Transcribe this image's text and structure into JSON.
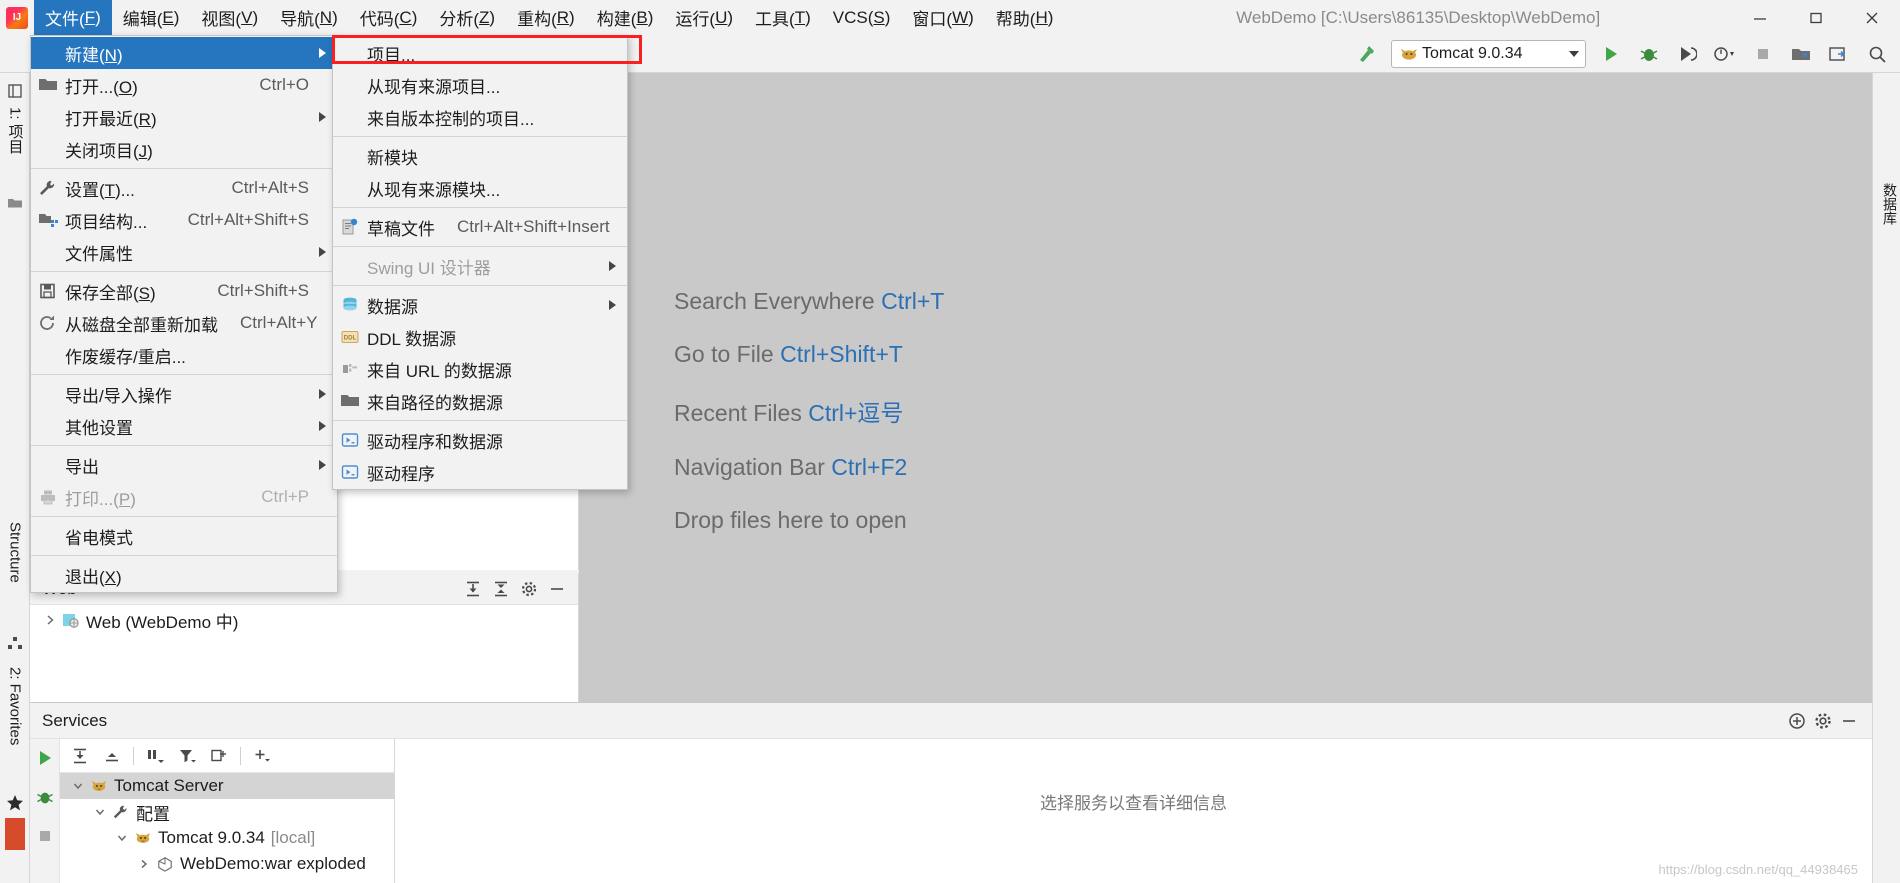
{
  "window": {
    "title": "WebDemo [C:\\Users\\86135\\Desktop\\WebDemo]",
    "logo_name": "intellij-idea-logo",
    "minimize_label": "最小化",
    "maximize_label": "最大化",
    "close_label": "关闭"
  },
  "menubar": [
    {
      "label": "文件(F)",
      "mnemonic": "F",
      "active": true
    },
    {
      "label": "编辑(E)",
      "mnemonic": "E",
      "active": false
    },
    {
      "label": "视图(V)",
      "mnemonic": "V",
      "active": false
    },
    {
      "label": "导航(N)",
      "mnemonic": "N",
      "active": false
    },
    {
      "label": "代码(C)",
      "mnemonic": "C",
      "active": false
    },
    {
      "label": "分析(Z)",
      "mnemonic": "Z",
      "active": false
    },
    {
      "label": "重构(R)",
      "mnemonic": "R",
      "active": false
    },
    {
      "label": "构建(B)",
      "mnemonic": "B",
      "active": false
    },
    {
      "label": "运行(U)",
      "mnemonic": "U",
      "active": false
    },
    {
      "label": "工具(T)",
      "mnemonic": "T",
      "active": false
    },
    {
      "label": "VCS(S)",
      "mnemonic": "S",
      "active": false
    },
    {
      "label": "窗口(W)",
      "mnemonic": "W",
      "active": false
    },
    {
      "label": "帮助(H)",
      "mnemonic": "H",
      "active": false
    }
  ],
  "file_menu": [
    {
      "label": "新建(N)",
      "icon": "",
      "accel": "",
      "submenu": true,
      "highlight": true,
      "disabled": false
    },
    {
      "label": "打开...(O)",
      "icon": "folder-icon",
      "accel": "Ctrl+O",
      "submenu": false,
      "highlight": false,
      "disabled": false
    },
    {
      "label": "打开最近(R)",
      "icon": "",
      "accel": "",
      "submenu": true,
      "highlight": false,
      "disabled": false
    },
    {
      "label": "关闭项目(J)",
      "icon": "",
      "accel": "",
      "submenu": false,
      "highlight": false,
      "disabled": false
    },
    {
      "separator": true
    },
    {
      "label": "设置(T)...",
      "icon": "wrench-icon",
      "accel": "Ctrl+Alt+S",
      "submenu": false,
      "highlight": false,
      "disabled": false
    },
    {
      "label": "项目结构...",
      "icon": "project-structure-icon",
      "accel": "Ctrl+Alt+Shift+S",
      "submenu": false,
      "highlight": false,
      "disabled": false
    },
    {
      "label": "文件属性",
      "icon": "",
      "accel": "",
      "submenu": true,
      "highlight": false,
      "disabled": false
    },
    {
      "separator": true
    },
    {
      "label": "保存全部(S)",
      "icon": "save-icon",
      "accel": "Ctrl+Shift+S",
      "submenu": false,
      "highlight": false,
      "disabled": false
    },
    {
      "label": "从磁盘全部重新加载",
      "icon": "reload-icon",
      "accel": "Ctrl+Alt+Y",
      "submenu": false,
      "highlight": false,
      "disabled": false
    },
    {
      "label": "作废缓存/重启...",
      "icon": "",
      "accel": "",
      "submenu": false,
      "highlight": false,
      "disabled": false
    },
    {
      "separator": true
    },
    {
      "label": "导出/导入操作",
      "icon": "",
      "accel": "",
      "submenu": true,
      "highlight": false,
      "disabled": false
    },
    {
      "label": "其他设置",
      "icon": "",
      "accel": "",
      "submenu": true,
      "highlight": false,
      "disabled": false
    },
    {
      "separator": true
    },
    {
      "label": "导出",
      "icon": "",
      "accel": "",
      "submenu": true,
      "highlight": false,
      "disabled": false
    },
    {
      "label": "打印...(P)",
      "icon": "printer-icon",
      "accel": "Ctrl+P",
      "submenu": false,
      "highlight": false,
      "disabled": true
    },
    {
      "separator": true
    },
    {
      "label": "省电模式",
      "icon": "",
      "accel": "",
      "submenu": false,
      "highlight": false,
      "disabled": false
    },
    {
      "separator": true
    },
    {
      "label": "退出(X)",
      "icon": "",
      "accel": "",
      "submenu": false,
      "highlight": false,
      "disabled": false
    }
  ],
  "new_submenu": [
    {
      "label": "项目...",
      "icon": "",
      "accel": "",
      "submenu": false,
      "highlight": false,
      "disabled": false,
      "outlined": true
    },
    {
      "label": "从现有来源项目...",
      "icon": "",
      "accel": "",
      "submenu": false,
      "highlight": false,
      "disabled": false
    },
    {
      "label": "来自版本控制的项目...",
      "icon": "",
      "accel": "",
      "submenu": false,
      "highlight": false,
      "disabled": false
    },
    {
      "separator": true
    },
    {
      "label": "新模块",
      "icon": "",
      "accel": "",
      "submenu": false,
      "highlight": false,
      "disabled": false
    },
    {
      "label": "从现有来源模块...",
      "icon": "",
      "accel": "",
      "submenu": false,
      "highlight": false,
      "disabled": false
    },
    {
      "separator": true
    },
    {
      "label": "草稿文件",
      "icon": "scratch-file-icon",
      "accel": "Ctrl+Alt+Shift+Insert",
      "submenu": false,
      "highlight": false,
      "disabled": false
    },
    {
      "separator": true
    },
    {
      "label": "Swing UI 设计器",
      "icon": "",
      "accel": "",
      "submenu": true,
      "highlight": false,
      "disabled": true
    },
    {
      "separator": true
    },
    {
      "label": "数据源",
      "icon": "database-icon",
      "accel": "",
      "submenu": true,
      "highlight": false,
      "disabled": false
    },
    {
      "label": "DDL 数据源",
      "icon": "ddl-icon",
      "accel": "",
      "submenu": false,
      "highlight": false,
      "disabled": false
    },
    {
      "label": "来自 URL 的数据源",
      "icon": "url-datasource-icon",
      "accel": "",
      "submenu": false,
      "highlight": false,
      "disabled": false
    },
    {
      "label": "来自路径的数据源",
      "icon": "folder-icon",
      "accel": "",
      "submenu": false,
      "highlight": false,
      "disabled": false
    },
    {
      "separator": true
    },
    {
      "label": "驱动程序和数据源",
      "icon": "driver-icon",
      "accel": "",
      "submenu": false,
      "highlight": false,
      "disabled": false
    },
    {
      "label": "驱动程序",
      "icon": "driver-icon",
      "accel": "",
      "submenu": false,
      "highlight": false,
      "disabled": false
    }
  ],
  "toolbar": {
    "build_label": "构建",
    "run_config": {
      "label": "Tomcat 9.0.34",
      "icon": "tomcat-icon"
    },
    "buttons": [
      {
        "name": "run-button",
        "glyph": "play",
        "color": "#4ca750"
      },
      {
        "name": "debug-button",
        "glyph": "debug",
        "color": "#3c8c3e"
      },
      {
        "name": "run-with-coverage-button",
        "glyph": "coverage",
        "color": "#4a4a4a"
      },
      {
        "name": "profiler-button",
        "glyph": "profiler",
        "color": "#4a4a4a"
      },
      {
        "name": "stop-button",
        "glyph": "stop",
        "color": "#a0a0a0"
      },
      {
        "name": "open-project-structure-button",
        "glyph": "structure",
        "color": "#4a4a4a"
      },
      {
        "name": "update-app-button",
        "glyph": "update",
        "color": "#4a4a4a"
      },
      {
        "name": "search-everywhere-button",
        "glyph": "search",
        "color": "#4a4a4a"
      }
    ]
  },
  "left_rail": [
    {
      "label": "1: 项目",
      "name": "tool-window-project"
    },
    {
      "label": "Structure",
      "name": "tool-window-structure"
    },
    {
      "label": "2: Favorites",
      "name": "tool-window-favorites"
    }
  ],
  "right_rail": [
    {
      "label": "数据库",
      "name": "tool-window-database"
    }
  ],
  "web_panel": {
    "title": "Web",
    "actions": [
      "expand-all-icon",
      "collapse-all-icon",
      "settings-icon",
      "hide-icon"
    ],
    "tree": [
      {
        "label": "Web (WebDemo 中)",
        "icon": "web-module-icon",
        "expanded": false,
        "indent": 0
      }
    ]
  },
  "editor_hints": [
    {
      "text": "Search Everywhere ",
      "key": "Ctrl+T"
    },
    {
      "text": "Go to File ",
      "key": "Ctrl+Shift+T"
    },
    {
      "text": "Recent Files ",
      "key": "Ctrl+逗号"
    },
    {
      "text": "Navigation Bar ",
      "key": "Ctrl+F2"
    },
    {
      "text": "Drop files here to open",
      "key": ""
    }
  ],
  "services": {
    "title": "Services",
    "actions": [
      "add-service-icon",
      "settings-icon",
      "hide-icon"
    ],
    "run_rail": [
      {
        "name": "rerun-button",
        "glyph": "play"
      },
      {
        "name": "debug-button",
        "glyph": "debug"
      },
      {
        "name": "stop-button",
        "glyph": "stop"
      }
    ],
    "toolbar": [
      {
        "name": "expand-all-icon"
      },
      {
        "name": "collapse-all-icon"
      },
      {
        "name": "group-by-icon"
      },
      {
        "name": "filter-icon"
      },
      {
        "name": "add-tab-icon"
      },
      {
        "name": "add-icon"
      }
    ],
    "tree": [
      {
        "label": "Tomcat Server",
        "icon": "tomcat-icon",
        "indent": 0,
        "expanded": true,
        "selected": true,
        "suffix": ""
      },
      {
        "label": "配置",
        "icon": "wrench-icon",
        "indent": 1,
        "expanded": true,
        "selected": false,
        "suffix": ""
      },
      {
        "label": "Tomcat 9.0.34",
        "icon": "tomcat-icon",
        "indent": 2,
        "expanded": true,
        "selected": false,
        "suffix": "[local]"
      },
      {
        "label": "WebDemo:war exploded",
        "icon": "artifact-icon",
        "indent": 3,
        "expanded": false,
        "selected": false,
        "suffix": ""
      }
    ],
    "detail_message": "选择服务以查看详细信息"
  },
  "watermark": "https://blog.csdn.net/qq_44938465",
  "colors": {
    "accent_blue": "#2675bf",
    "link_blue": "#2b6fb5",
    "highlight_red": "#fc1f1f",
    "panel_bg": "#f2f2f2",
    "editor_bg": "#c9c9c9",
    "selected_row": "#d4d4d4"
  }
}
